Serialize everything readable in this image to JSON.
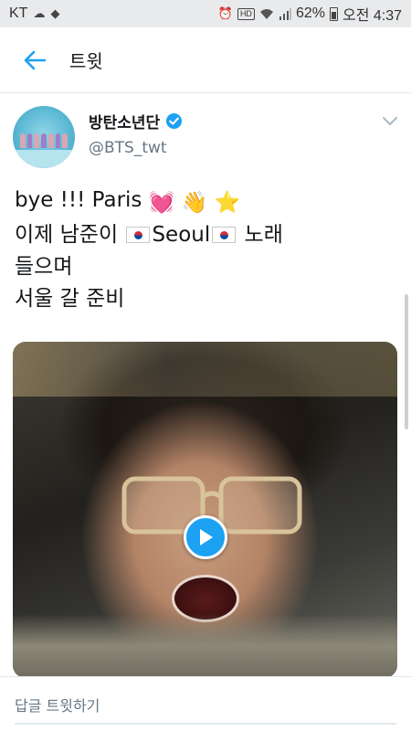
{
  "status_bar": {
    "carrier": "KT",
    "battery": "62%",
    "time": "오전 4:37",
    "hd_label": "HD"
  },
  "app_bar": {
    "title": "트윗"
  },
  "tweet": {
    "display_name": "방탄소년단",
    "handle": "@BTS_twt",
    "lines": [
      "bye !!! Paris",
      "이제 남준이",
      "Seoul",
      "노래",
      "들으며",
      "서울 갈 준비"
    ]
  },
  "reply": {
    "placeholder": "답글 트윗하기"
  },
  "colors": {
    "accent": "#1da1f2",
    "text": "#14171a",
    "secondary": "#657786"
  },
  "icons": {
    "back": "arrow-left-icon",
    "verified": "verified-badge-icon",
    "caret": "chevron-down-icon",
    "play": "play-icon"
  }
}
